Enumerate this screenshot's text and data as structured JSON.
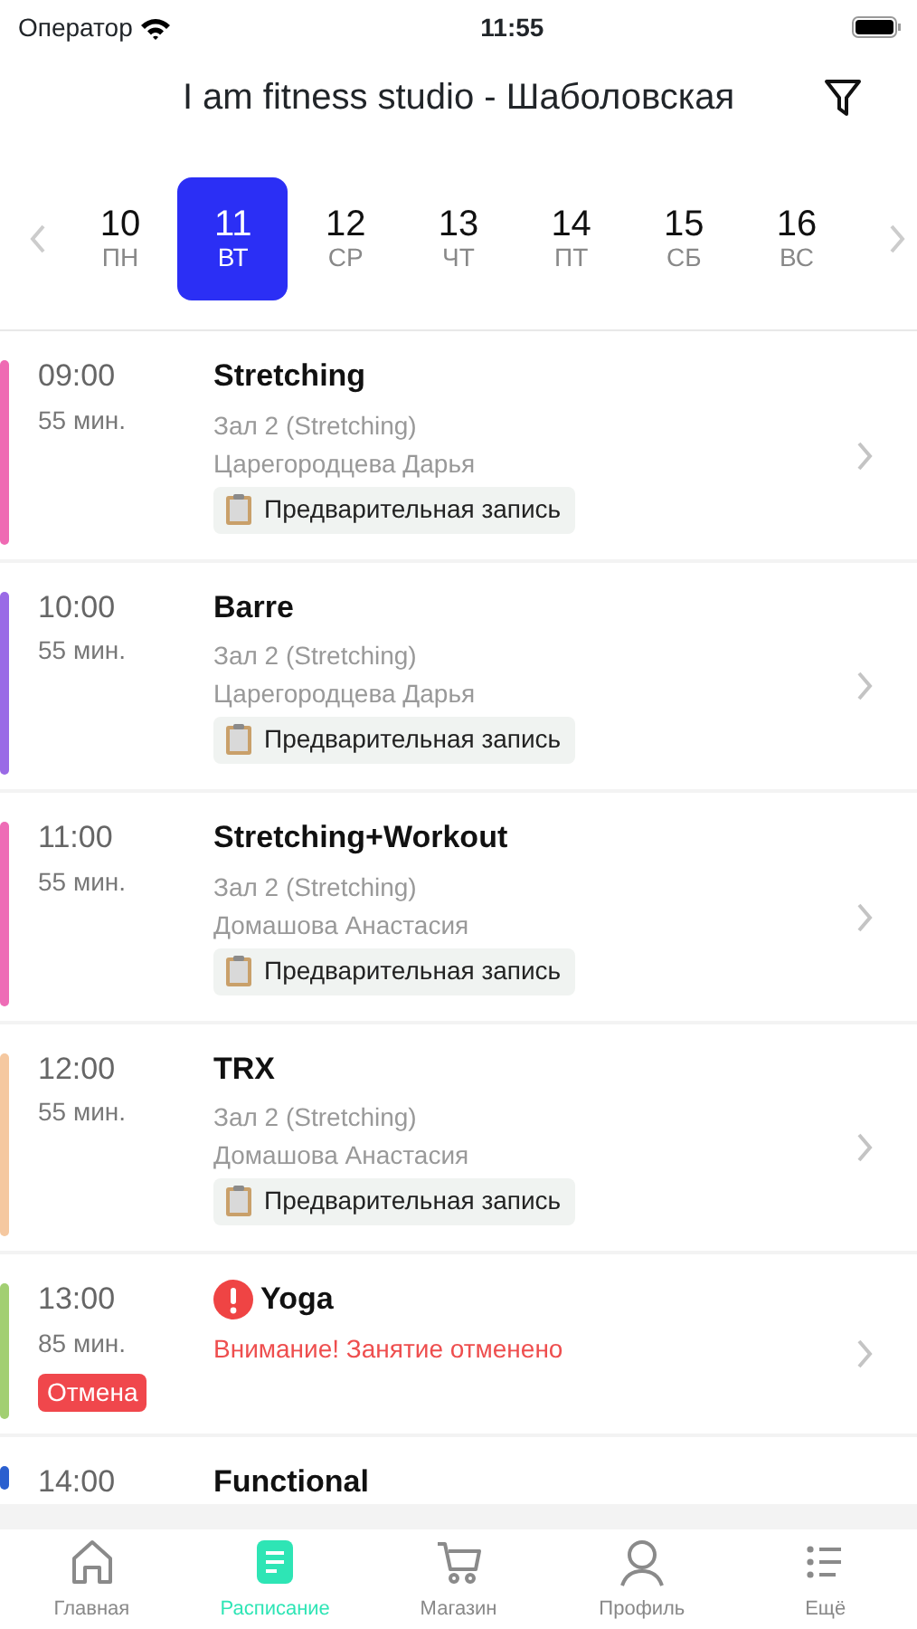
{
  "status_bar": {
    "carrier": "Оператор",
    "time": "11:55"
  },
  "header": {
    "title": "I am fitness studio - Шаболовская"
  },
  "days": [
    {
      "date": "10",
      "weekday": "ПН",
      "selected": false
    },
    {
      "date": "11",
      "weekday": "ВТ",
      "selected": true
    },
    {
      "date": "12",
      "weekday": "СР",
      "selected": false
    },
    {
      "date": "13",
      "weekday": "ЧТ",
      "selected": false
    },
    {
      "date": "14",
      "weekday": "ПТ",
      "selected": false
    },
    {
      "date": "15",
      "weekday": "СБ",
      "selected": false
    },
    {
      "date": "16",
      "weekday": "ВС",
      "selected": false
    }
  ],
  "classes": [
    {
      "kind": "class",
      "color": "#ef6ab3",
      "time": "09:00",
      "duration": "55 мин.",
      "title": "Stretching",
      "room": "Зал 2 (Stretching)",
      "trainer": "Царегородцева Дарья",
      "booking": "Предварительная запись"
    },
    {
      "kind": "class",
      "color": "#9a6ae6",
      "time": "10:00",
      "duration": "55 мин.",
      "title": "Barre",
      "room": "Зал 2 (Stretching)",
      "trainer": "Царегородцева Дарья",
      "booking": "Предварительная запись"
    },
    {
      "kind": "class",
      "color": "#ee6cb6",
      "time": "11:00",
      "duration": "55 мин.",
      "title": "Stretching+Workout",
      "room": "Зал 2 (Stretching)",
      "trainer": "Домашова Анастасия",
      "booking": "Предварительная запись"
    },
    {
      "kind": "class",
      "color": "#f5c8a0",
      "time": "12:00",
      "duration": "55 мин.",
      "title": "TRX",
      "room": "Зал 2 (Stretching)",
      "trainer": "Домашова Анастасия",
      "booking": "Предварительная запись"
    },
    {
      "kind": "cancelled",
      "color": "#a2cf72",
      "time": "13:00",
      "duration": "85 мин.",
      "title": "Yoga",
      "warning": "Внимание! Занятие отменено",
      "badge": "Отмена"
    },
    {
      "kind": "partial",
      "color": "#2a5fcf",
      "time": "14:00",
      "title": "Functional"
    }
  ],
  "tab_bar": [
    {
      "kind": "home",
      "label": "Главная",
      "selected": false
    },
    {
      "kind": "schedule",
      "label": "Расписание",
      "selected": true
    },
    {
      "kind": "cart",
      "label": "Магазин",
      "selected": false
    },
    {
      "kind": "profile",
      "label": "Профиль",
      "selected": false
    },
    {
      "kind": "more",
      "label": "Ещё",
      "selected": false
    }
  ]
}
